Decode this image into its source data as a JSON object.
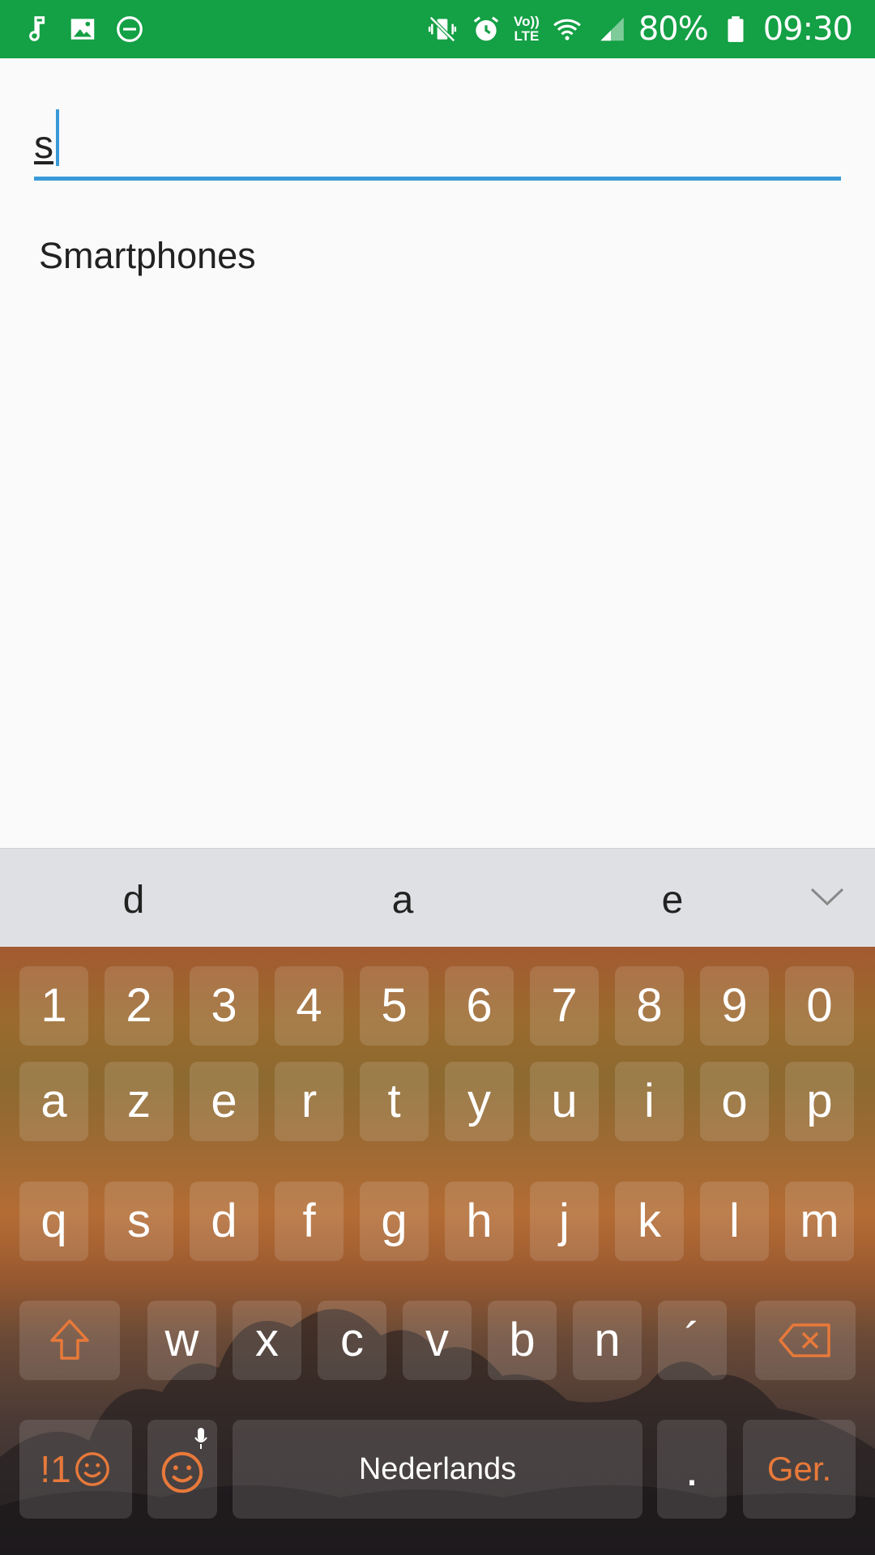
{
  "status_bar": {
    "left_icons": [
      "music-note-icon",
      "image-icon",
      "do-not-disturb-icon"
    ],
    "right_icons": [
      "vibrate-icon",
      "alarm-icon",
      "volte-icon",
      "wifi-icon",
      "signal-icon",
      "battery-icon"
    ],
    "volte_line1": "Vo))",
    "volte_line2": "LTE",
    "battery": "80%",
    "time": "09:30",
    "background": "#14a045"
  },
  "search": {
    "value": "s",
    "accent": "#3a9ad9"
  },
  "suggestions": [
    "Smartphones"
  ],
  "predictions": [
    "d",
    "a",
    "e"
  ],
  "keyboard": {
    "accent": "#e8793a",
    "row_numbers": [
      "1",
      "2",
      "3",
      "4",
      "5",
      "6",
      "7",
      "8",
      "9",
      "0"
    ],
    "row_1": [
      "a",
      "z",
      "e",
      "r",
      "t",
      "y",
      "u",
      "i",
      "o",
      "p"
    ],
    "row_2": [
      "q",
      "s",
      "d",
      "f",
      "g",
      "h",
      "j",
      "k",
      "l",
      "m"
    ],
    "row_3": [
      "w",
      "x",
      "c",
      "v",
      "b",
      "n",
      "´"
    ],
    "symbols_label": "!1",
    "space_label": "Nederlands",
    "period_label": ".",
    "enter_label": "Ger."
  }
}
